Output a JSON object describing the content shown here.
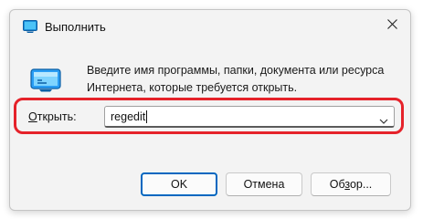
{
  "window": {
    "title": "Выполнить",
    "icon": "run-app-icon",
    "close_icon": "close-icon"
  },
  "dialog": {
    "icon": "run-dialog-icon",
    "description_line1": "Введите имя программы, папки, документа или ресурса",
    "description_line2": "Интернета, которые требуется открыть.",
    "open_label_prefix": "О",
    "open_label_rest": "ткрыть:",
    "input_value": "regedit",
    "dropdown_icon": "chevron-down-icon",
    "highlight_color": "#e5222a"
  },
  "buttons": {
    "ok_label": "OK",
    "cancel_label": "Отмена",
    "browse_prefix": "Об",
    "browse_accel": "з",
    "browse_rest": "ор...",
    "accent_color": "#0067c0"
  }
}
